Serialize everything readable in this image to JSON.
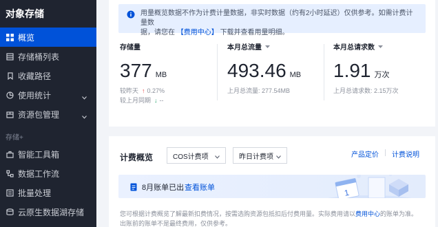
{
  "sidebar": {
    "title": "对象存储",
    "items": [
      {
        "label": "概览",
        "icon": "grid-icon",
        "active": true
      },
      {
        "label": "存储桶列表",
        "icon": "bucket-list-icon"
      },
      {
        "label": "收藏路径",
        "icon": "bookmark-icon"
      },
      {
        "label": "使用统计",
        "icon": "pie-chart-icon",
        "has_children": true
      },
      {
        "label": "资源包管理",
        "icon": "package-icon",
        "has_children": true
      }
    ],
    "group_label": "存储+",
    "group_items": [
      {
        "label": "智能工具箱",
        "icon": "toolbox-icon"
      },
      {
        "label": "数据工作流",
        "icon": "workflow-icon"
      },
      {
        "label": "批量处理",
        "icon": "batch-icon"
      },
      {
        "label": "云原生数据湖存储",
        "icon": "data-lake-icon"
      }
    ]
  },
  "notice": {
    "text_1": "用量概览数据不作为计费计量数据，非实时数据（约有2小时延迟）仅供参考。如需计费计量数",
    "text_2": "据，请您在",
    "link": "【费用中心】",
    "text_3": "下载并查看用量明细。"
  },
  "stats": [
    {
      "label": "存储量",
      "value": "377",
      "unit": "MB",
      "compare_1_label": "较昨天",
      "compare_1_value": "0.27%",
      "compare_1_dir": "up",
      "compare_2_label": "较上月同期",
      "compare_2_value": "--",
      "compare_2_dir": "down"
    },
    {
      "label": "本月总流量",
      "value": "493.46",
      "unit": "MB",
      "sub": "上月总流量: 277.54MB"
    },
    {
      "label": "本月总请求数",
      "value": "1.91",
      "unit": "万次",
      "sub": "上月总请求数: 2.15万次"
    }
  ],
  "billing": {
    "title": "计费概览",
    "select_1": "COS计费项",
    "select_2": "昨日计费项",
    "link_pricing": "产品定价",
    "link_billing": "计费说明",
    "banner_text": "8月账单已出",
    "banner_link": "查看账单",
    "footer_1": "您可根据计费概览了解最新扣费情况，按需选购资源包抵扣后付费用量。实际费用请以",
    "footer_link": "费用中心",
    "footer_2": "的账单为准。",
    "footer_3": "出账前的账单不是最终费用，仅供参考。"
  },
  "colors": {
    "brand": "#0052d9",
    "sidebar_bg": "#1f2430",
    "up": "#e54545",
    "down": "#2ba471"
  }
}
